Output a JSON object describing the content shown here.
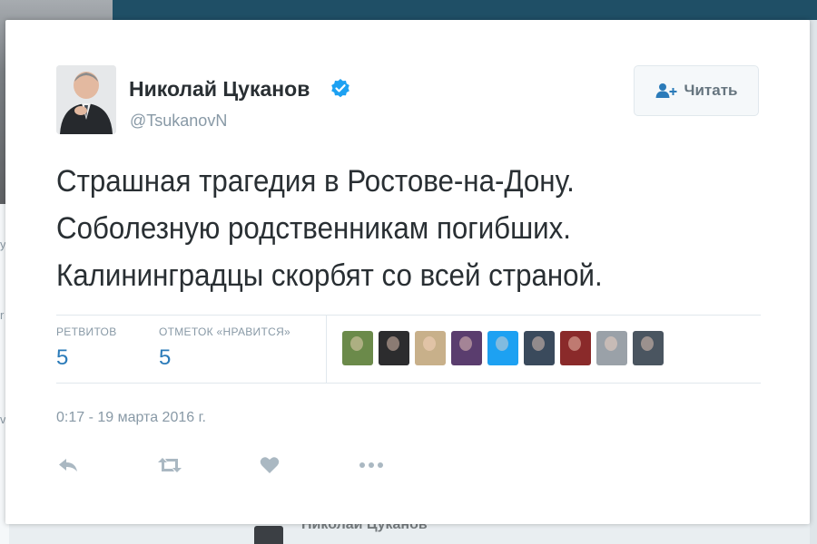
{
  "tweet": {
    "author": {
      "name": "Николай Цуканов",
      "handle": "@TsukanovN",
      "verified": true
    },
    "follow_button": {
      "label": "Читать",
      "icon": "add-user-icon"
    },
    "text_lines": [
      "Страшная трагедия в Ростове-на-Дону.",
      "Соболезную родственникам погибших.",
      "Калининградцы скорбят со всей страной."
    ],
    "stats": {
      "retweets_label": "РЕТВИТОВ",
      "retweets": "5",
      "likes_label": "ОТМЕТОК «НРАВИТСЯ»",
      "likes": "5"
    },
    "liker_avatars": [
      {
        "color": "#6b8a4a"
      },
      {
        "color": "#2c2c2e"
      },
      {
        "color": "#c8b08a"
      },
      {
        "color": "#5a3d6e"
      },
      {
        "color": "#1da1f2"
      },
      {
        "color": "#3a4a5c"
      },
      {
        "color": "#8a2a2a"
      },
      {
        "color": "#9aa1a8"
      },
      {
        "color": "#4a5560"
      }
    ],
    "timestamp": "0:17 - 19 марта 2016 г.",
    "actions": [
      "reply-icon",
      "retweet-icon",
      "like-icon",
      "more-icon"
    ]
  },
  "background": {
    "next_tweet_author": "Николай Цуканов",
    "left_marks": [
      "y",
      "r",
      "v"
    ]
  },
  "colors": {
    "accent": "#2b7bb9",
    "text": "#292f33",
    "muted": "#8899a6",
    "verified": "#1da1f2",
    "header": "#1f4f66"
  }
}
